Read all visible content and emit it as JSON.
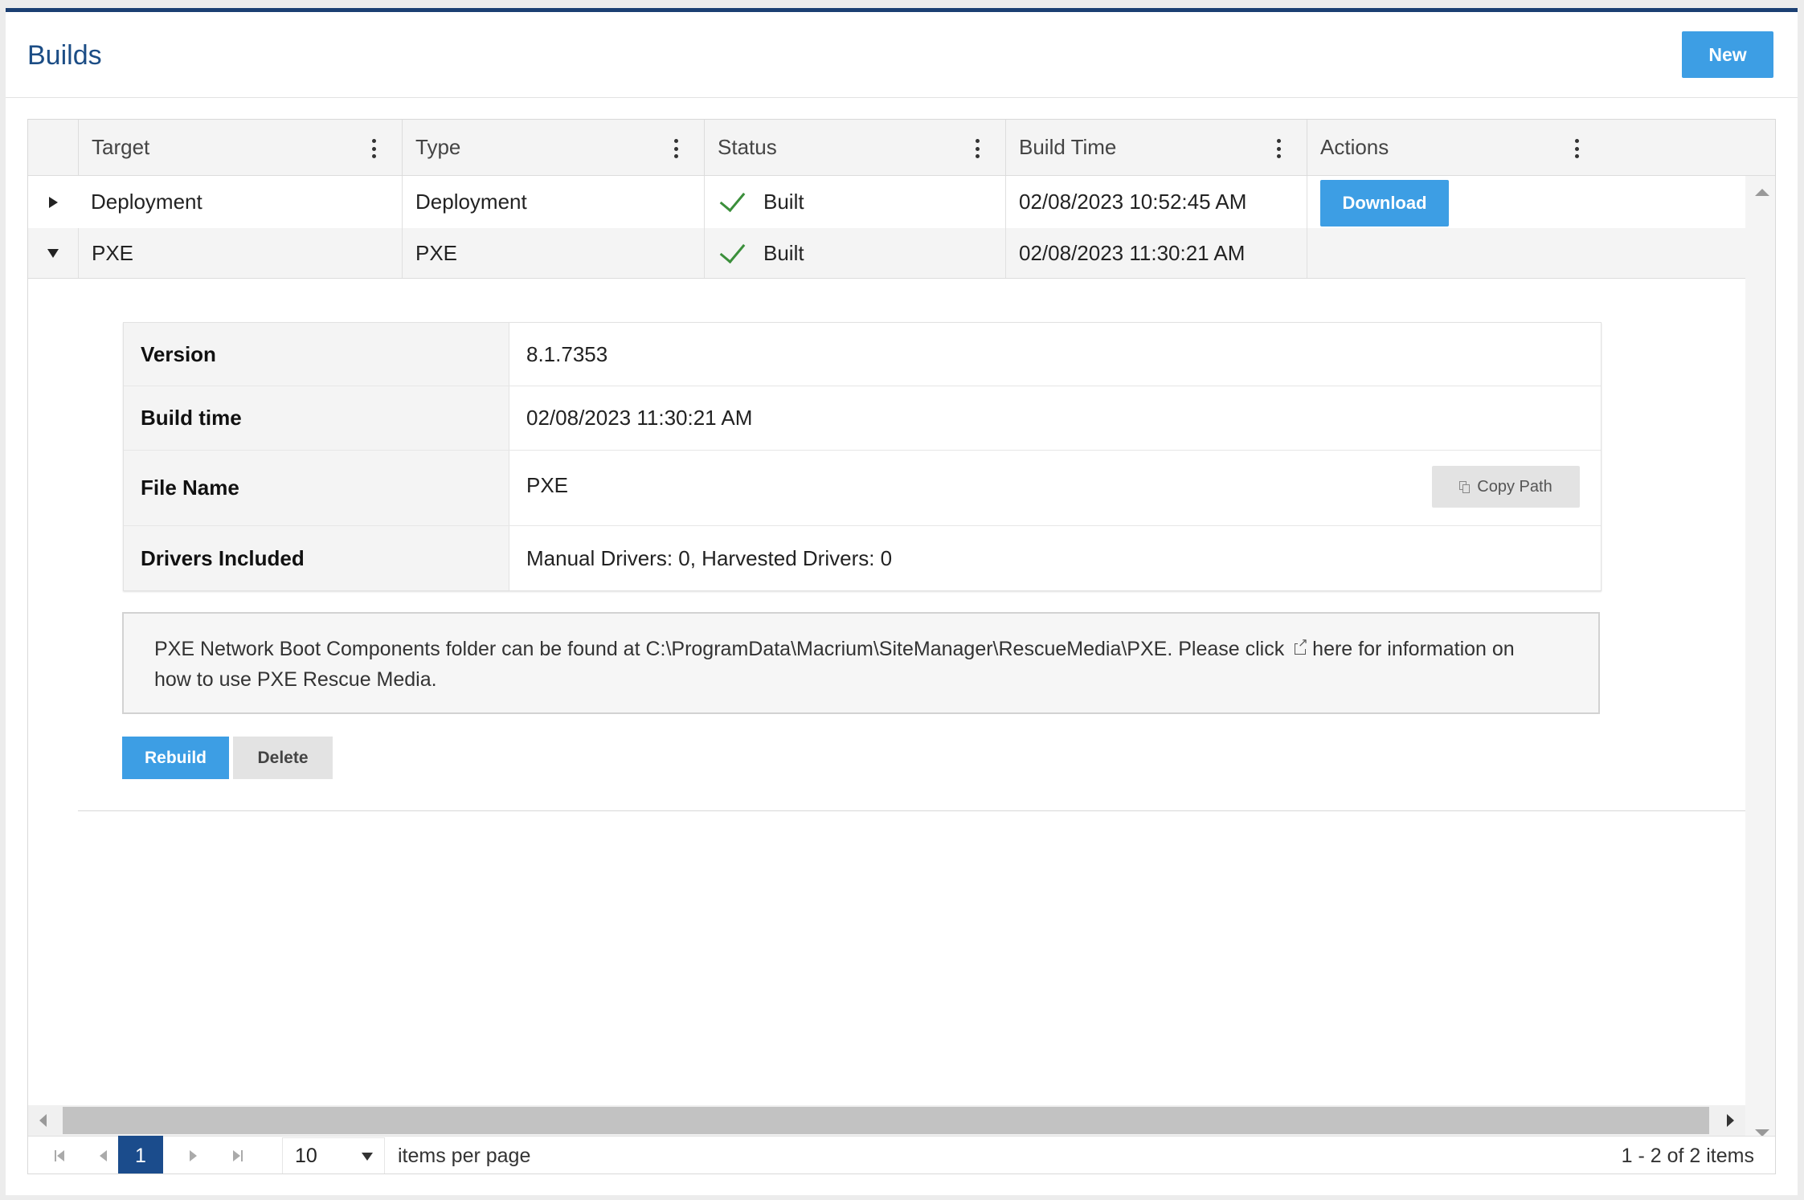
{
  "header": {
    "title": "Builds",
    "new_label": "New"
  },
  "columns": [
    "Target",
    "Type",
    "Status",
    "Build Time",
    "Actions"
  ],
  "rows": [
    {
      "target": "Deployment",
      "type": "Deployment",
      "status": "Built",
      "build_time": "02/08/2023 10:52:45 AM",
      "action": "Download",
      "expanded": false
    },
    {
      "target": "PXE",
      "type": "PXE",
      "status": "Built",
      "build_time": "02/08/2023 11:30:21 AM",
      "action": "",
      "expanded": true
    }
  ],
  "detail": {
    "version_label": "Version",
    "version": "8.1.7353",
    "build_time_label": "Build time",
    "build_time": "02/08/2023 11:30:21 AM",
    "file_name_label": "File Name",
    "file_name": "PXE",
    "copy_path_label": "Copy Path",
    "drivers_label": "Drivers Included",
    "drivers": "Manual Drivers: 0, Harvested Drivers: 0",
    "info_text_1": "PXE Network Boot Components folder can be found at C:\\ProgramData\\Macrium\\SiteManager\\RescueMedia\\PXE. Please click",
    "info_link": "here for information on",
    "info_text_2": "how to use PXE Rescue Media.",
    "rebuild_label": "Rebuild",
    "delete_label": "Delete"
  },
  "pager": {
    "current_page": "1",
    "page_size": "10",
    "items_per_page_label": "items per page",
    "summary": "1 - 2 of 2 items"
  },
  "colors": {
    "accent": "#3d9ee4",
    "title": "#1c4d85",
    "pager_active": "#1b4c8c",
    "check": "#3b8f3b"
  },
  "icons": [
    "kebab-menu-icon",
    "expand-arrow-icon",
    "collapse-arrow-icon",
    "check-icon",
    "copy-icon",
    "external-link-icon"
  ]
}
